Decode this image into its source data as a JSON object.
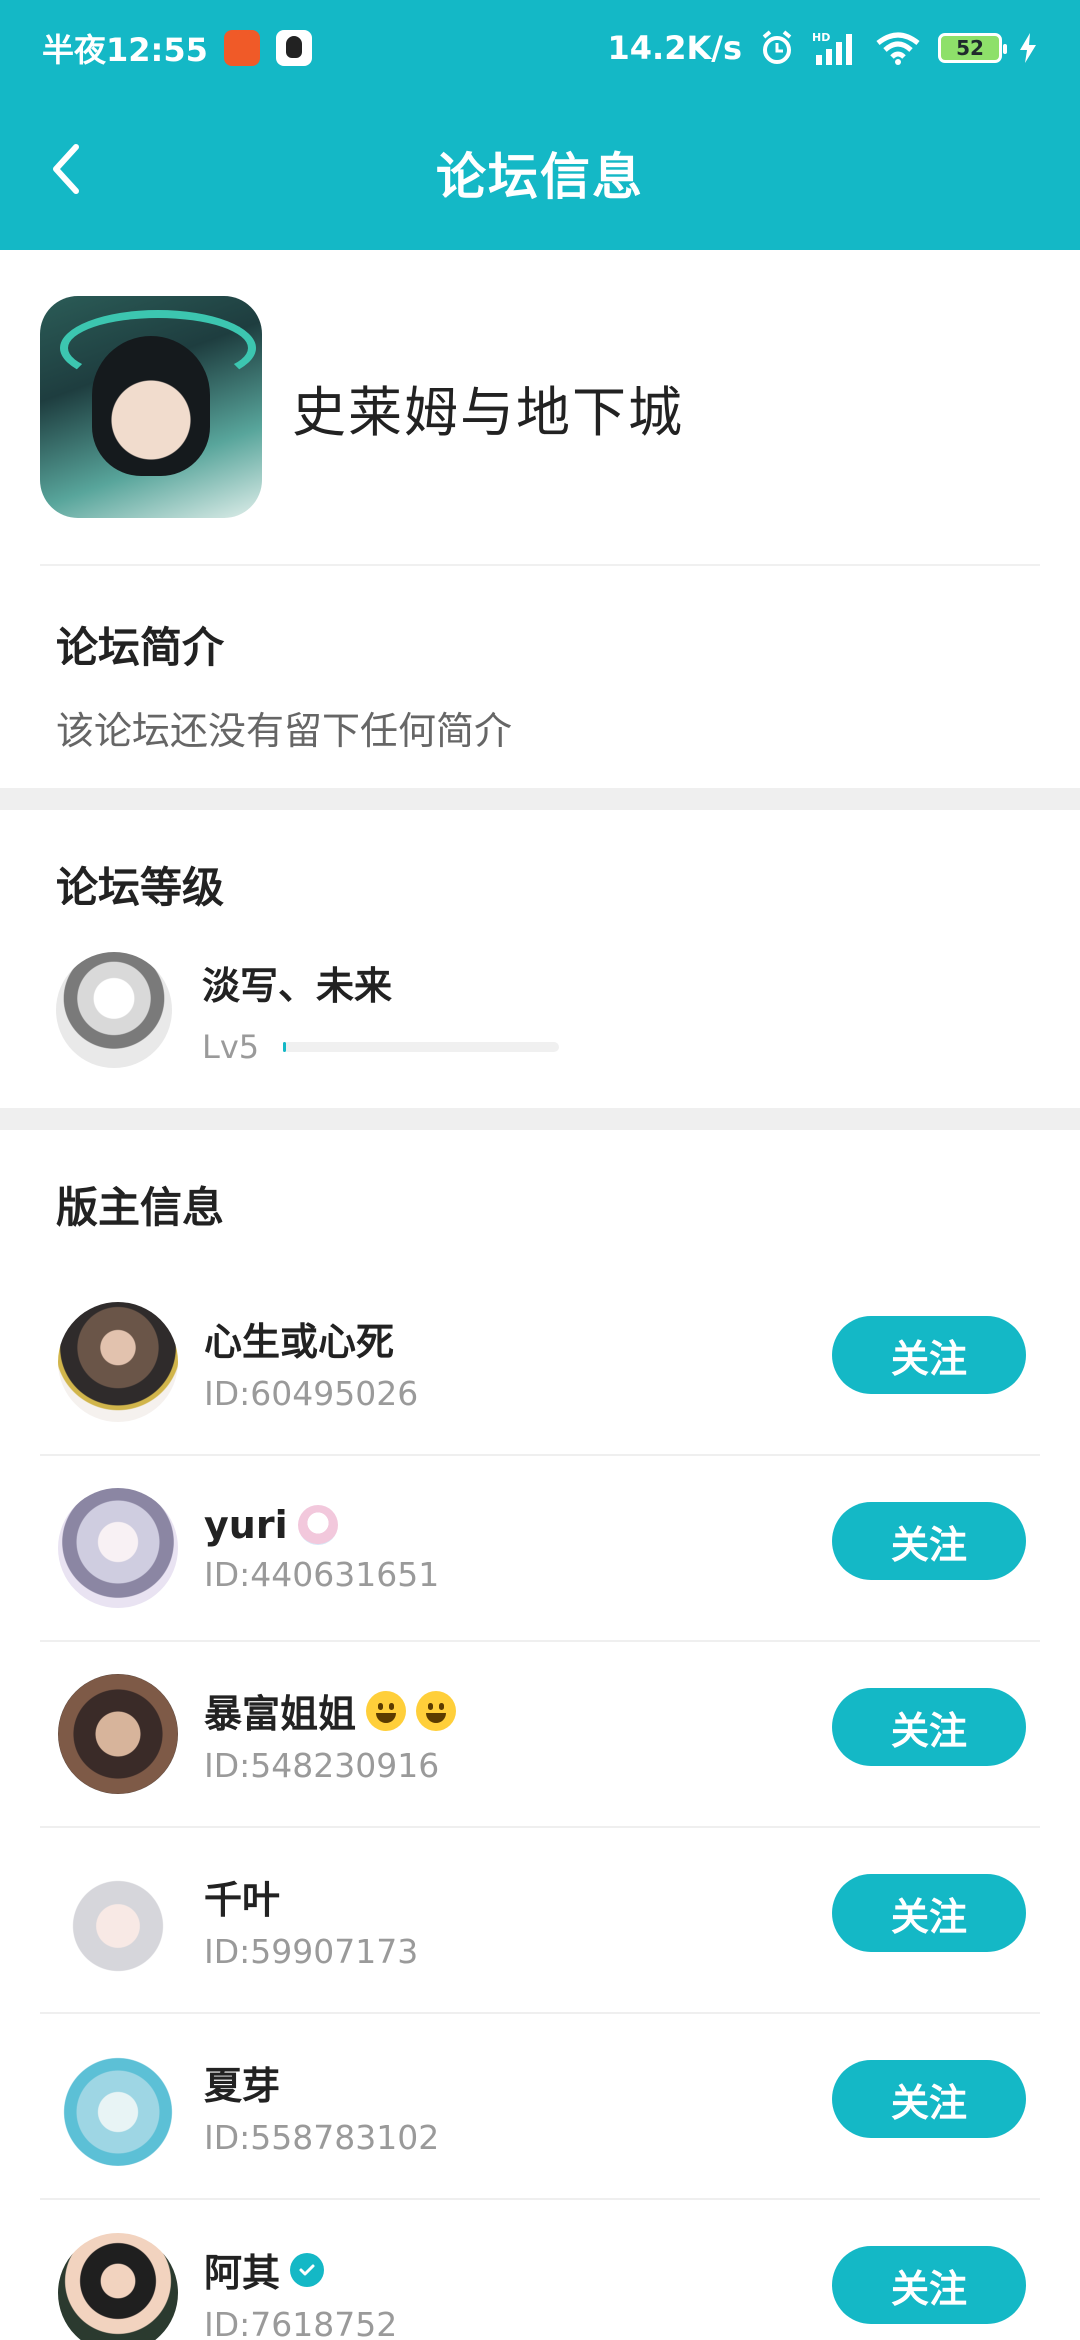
{
  "status_bar": {
    "time": "半夜12:55",
    "net_speed": "14.2K/s",
    "battery_level": "52",
    "icons": [
      "alarm-icon",
      "signal-icon",
      "wifi-icon",
      "battery-icon",
      "charging-icon"
    ]
  },
  "header": {
    "title": "论坛信息",
    "back_icon": "chevron-left-icon"
  },
  "forum": {
    "name": "史莱姆与地下城"
  },
  "intro": {
    "title": "论坛简介",
    "text": "该论坛还没有留下任何简介"
  },
  "level": {
    "title": "论坛等级",
    "user_name": "淡写、未来",
    "level_label": "Lv5",
    "progress_fraction": 0.01
  },
  "moderators": {
    "title": "版主信息",
    "follow_label": "关注",
    "items": [
      {
        "name": "心生或心死",
        "id": "ID:60495026"
      },
      {
        "name": "yuri",
        "id": "ID:440631651"
      },
      {
        "name": "暴富姐姐",
        "id": "ID:548230916"
      },
      {
        "name": "千叶",
        "id": "ID:59907173"
      },
      {
        "name": "夏芽",
        "id": "ID:558783102"
      },
      {
        "name": "阿其",
        "id": "ID:7618752"
      }
    ]
  },
  "colors": {
    "accent": "#14b8c6",
    "divider": "#efefef"
  }
}
